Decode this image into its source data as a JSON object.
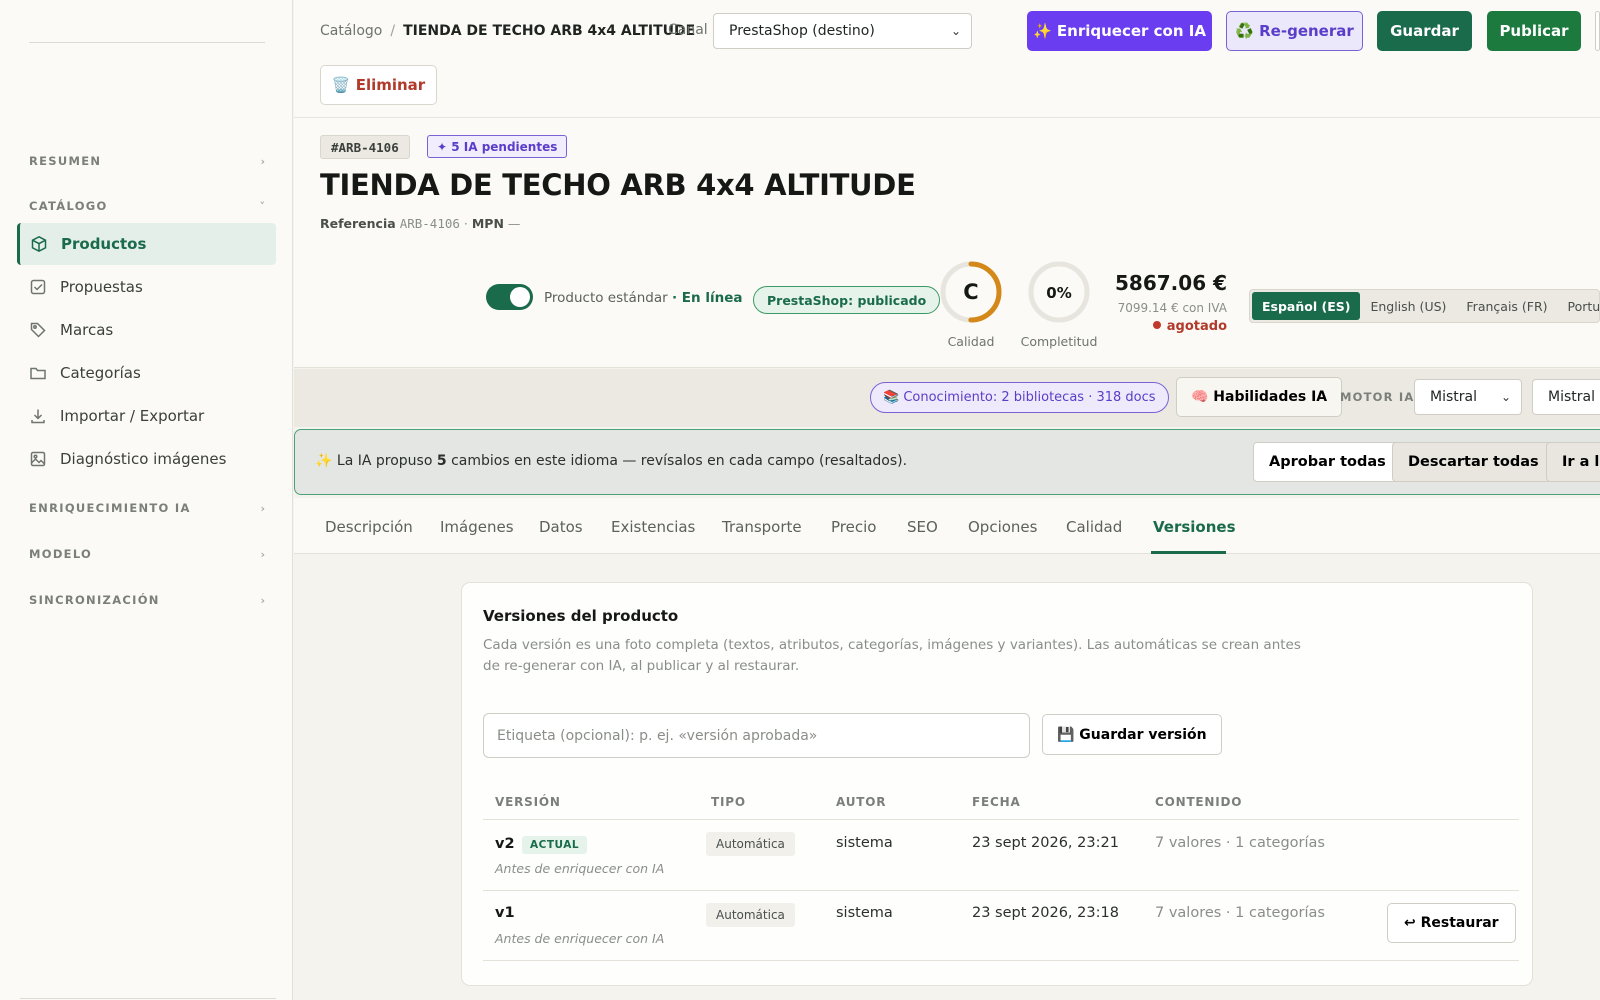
{
  "sidebar": {
    "sections": {
      "resumen": "RESUMEN",
      "catalogo": "CATÁLOGO",
      "enriquecimiento": "ENRIQUECIMIENTO IA",
      "modelo": "MODELO",
      "sincronizacion": "SINCRONIZACIÓN"
    },
    "items": [
      {
        "label": "Productos",
        "icon": "box-icon",
        "active": true
      },
      {
        "label": "Propuestas",
        "icon": "checkbox-icon"
      },
      {
        "label": "Marcas",
        "icon": "tag-icon"
      },
      {
        "label": "Categorías",
        "icon": "folder-icon"
      },
      {
        "label": "Importar / Exportar",
        "icon": "download-icon"
      },
      {
        "label": "Diagnóstico imágenes",
        "icon": "image-icon"
      }
    ]
  },
  "topbar": {
    "breadcrumb_root": "Catálogo",
    "breadcrumb_sep": "/",
    "breadcrumb_current": "TIENDA DE TECHO ARB 4x4 ALTITUDE",
    "canal_label": "Canal",
    "canal_value": "PrestaShop (destino)",
    "enrich_label": "✨ Enriquecer con IA",
    "regen_label": "♻️ Re-generar",
    "save_label": "Guardar",
    "publish_label": "Publicar",
    "delete_label": "🗑️ Eliminar"
  },
  "product": {
    "sku": "#ARB-4106",
    "ia_pending": "✦ 5 IA pendientes",
    "title": "TIENDA DE TECHO ARB 4x4 ALTITUDE",
    "ref_label": "Referencia",
    "ref_value": "ARB-4106",
    "mpn_label": "MPN",
    "mpn_value": "—",
    "toggle_on": true,
    "status_text": "Producto estándar",
    "status_online": "· En línea",
    "channel_status": "PrestaShop: publicado",
    "quality_grade": "C",
    "quality_label": "Calidad",
    "quality_fraction": 0.5,
    "completeness_value": "0%",
    "completeness_label": "Completitud",
    "completeness_fraction": 0,
    "price": "5867.06 €",
    "price_tax": "7099.14 € con IVA",
    "stock_status": "agotado",
    "languages": [
      {
        "label": "Español (ES)",
        "active": true
      },
      {
        "label": "English (US)"
      },
      {
        "label": "Français (FR)"
      },
      {
        "label": "Portu"
      }
    ]
  },
  "tools": {
    "knowledge": "📚 Conocimiento: 2 bibliotecas · 318 docs",
    "skills": "🧠 Habilidades IA",
    "motor_label": "MOTOR IA",
    "motor_value": "Mistral",
    "model_value": "Mistral L"
  },
  "banner": {
    "icon": "✨",
    "prefix": "La IA propuso",
    "count": "5",
    "suffix": "cambios en este idioma — revísalos en cada campo (resaltados).",
    "approve_all": "Aprobar todas",
    "discard_all": "Descartar todas",
    "goto": "Ir a la"
  },
  "tabs": [
    "Descripción",
    "Imágenes",
    "Datos",
    "Existencias",
    "Transporte",
    "Precio",
    "SEO",
    "Opciones",
    "Calidad",
    "Versiones"
  ],
  "versions": {
    "title": "Versiones del producto",
    "description": "Cada versión es una foto completa (textos, atributos, categorías, imágenes y variantes). Las automáticas se crean antes de re-generar con IA, al publicar y al restaurar.",
    "input_placeholder": "Etiqueta (opcional): p. ej. «versión aprobada»",
    "save_version": "💾 Guardar versión",
    "headers": {
      "version": "VERSIÓN",
      "tipo": "TIPO",
      "autor": "AUTOR",
      "fecha": "FECHA",
      "contenido": "CONTENIDO"
    },
    "actual_badge": "ACTUAL",
    "restore_label": "↩ Restaurar",
    "rows": [
      {
        "version": "v2",
        "note": "Antes de enriquecer con IA",
        "tipo": "Automática",
        "autor": "sistema",
        "fecha": "23 sept 2026, 23:21",
        "contenido": "7 valores · 1 categorías"
      },
      {
        "version": "v1",
        "note": "Antes de enriquecer con IA",
        "tipo": "Automática",
        "autor": "sistema",
        "fecha": "23 sept 2026, 23:18",
        "contenido": "7 valores · 1 categorías"
      }
    ]
  },
  "colors": {
    "accent": "#1a6a4c",
    "ai_purple": "#6b3df0",
    "danger": "#b23a2b",
    "quality_gauge": "#d4881a",
    "background": "#f4f3ed"
  }
}
